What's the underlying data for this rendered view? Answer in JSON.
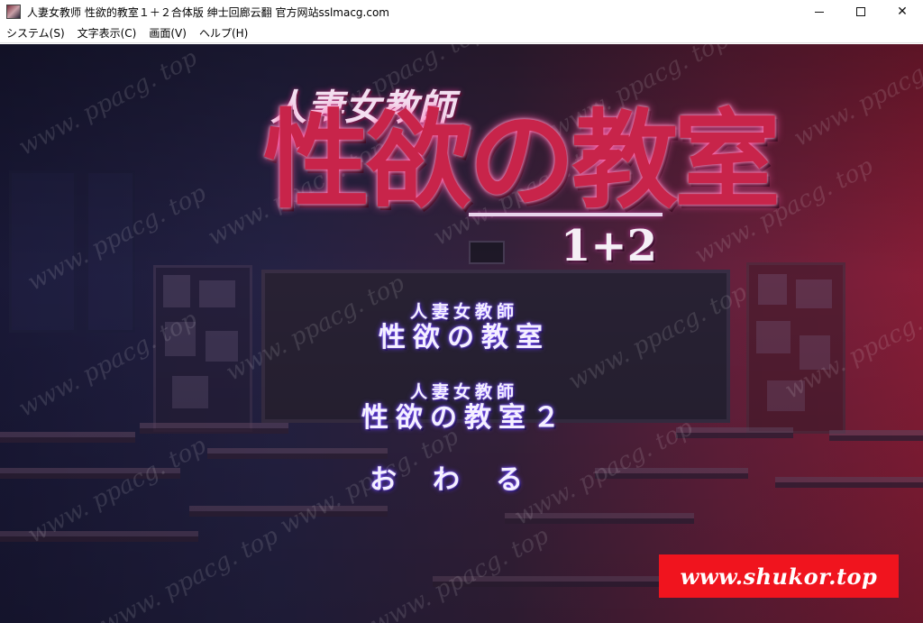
{
  "window": {
    "title": "人妻女教师 性欲的教室１＋２合体版 绅士回廊云翻 官方网站sslmacg.com",
    "controls": {
      "minimize": "—",
      "maximize": "☐",
      "close": "✕"
    }
  },
  "menubar": {
    "items": [
      "システム(S)",
      "文字表示(C)",
      "画面(V)",
      "ヘルプ(H)"
    ]
  },
  "logo": {
    "subtitle": "人妻女教師",
    "title": "性欲の教室",
    "number": "1+2"
  },
  "options": [
    {
      "sub": "人妻女教師",
      "main": "性欲の教室"
    },
    {
      "sub": "人妻女教師",
      "main": "性欲の教室２"
    },
    {
      "main": "おわる"
    }
  ],
  "watermark": "www. ppacg. top",
  "banner": {
    "text": "www.shukor.top",
    "color": "#f0141e"
  }
}
